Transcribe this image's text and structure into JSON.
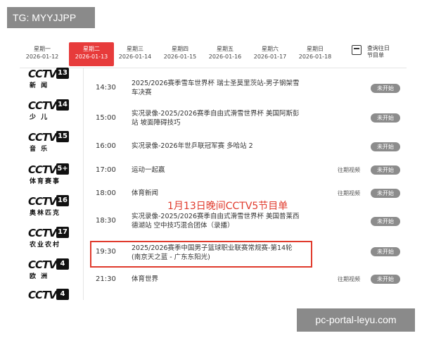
{
  "watermark_top": "TG: MYYJJPP",
  "watermark_bottom": "pc-portal-leyu.com",
  "dates": [
    {
      "weekday": "星期一",
      "date": "2026-01-12",
      "active": false
    },
    {
      "weekday": "星期二",
      "date": "2026-01-13",
      "active": true
    },
    {
      "weekday": "星期三",
      "date": "2026-01-14",
      "active": false
    },
    {
      "weekday": "星期四",
      "date": "2026-01-15",
      "active": false
    },
    {
      "weekday": "星期五",
      "date": "2026-01-16",
      "active": false
    },
    {
      "weekday": "星期六",
      "date": "2026-01-17",
      "active": false
    },
    {
      "weekday": "星期日",
      "date": "2026-01-18",
      "active": false
    }
  ],
  "calendar": {
    "line1": "查询往日",
    "line2": "节目单"
  },
  "channels": [
    {
      "logo": "CCTV",
      "num": "13",
      "sub": "新 闻"
    },
    {
      "logo": "CCTV",
      "num": "14",
      "sub": "少 儿"
    },
    {
      "logo": "CCTV",
      "num": "15",
      "sub": "音 乐"
    },
    {
      "logo": "CCTV",
      "num": "5+",
      "sub": "体育赛事"
    },
    {
      "logo": "CCTV",
      "num": "16",
      "sub": "奥林匹克"
    },
    {
      "logo": "CCTV",
      "num": "17",
      "sub": "农业农村"
    },
    {
      "logo": "CCTV",
      "num": "4",
      "sub": "欧 洲"
    },
    {
      "logo": "CCTV",
      "num": "4",
      "sub": ""
    }
  ],
  "programs": [
    {
      "time": "14:30",
      "title": "2025/2026赛季雪车世界杯 瑞士圣莫里茨站-男子钢架雪车决赛",
      "replay": "",
      "status": "未开始"
    },
    {
      "time": "15:00",
      "title": "实况录像-2025/2026赛季自由式滑雪世界杯 美国阿斯彭站 坡面障碍技巧",
      "replay": "",
      "status": "未开始"
    },
    {
      "time": "16:00",
      "title": "实况录像-2026年世乒联冠军赛 多哈站 2",
      "replay": "",
      "status": "未开始"
    },
    {
      "time": "17:00",
      "title": "运动一起赢",
      "replay": "往期视频",
      "status": "未开始"
    },
    {
      "time": "18:00",
      "title": "体育新闻",
      "replay": "往期视频",
      "status": "未开始"
    },
    {
      "time": "18:30",
      "title": "实况录像-2025/2026赛季自由式滑雪世界杯 美国普莱西德湖站 空中技巧混合团体（录播）",
      "replay": "",
      "status": "未开始"
    },
    {
      "time": "19:30",
      "title": "2025/2026赛季中国男子篮球职业联赛常规赛-第14轮(南京天之蓝 - 广东东阳光)",
      "replay": "",
      "status": "未开始"
    },
    {
      "time": "21:30",
      "title": "体育世界",
      "replay": "往期视频",
      "status": "未开始"
    }
  ],
  "annotation": "1月13日晚间CCTV5节目单"
}
